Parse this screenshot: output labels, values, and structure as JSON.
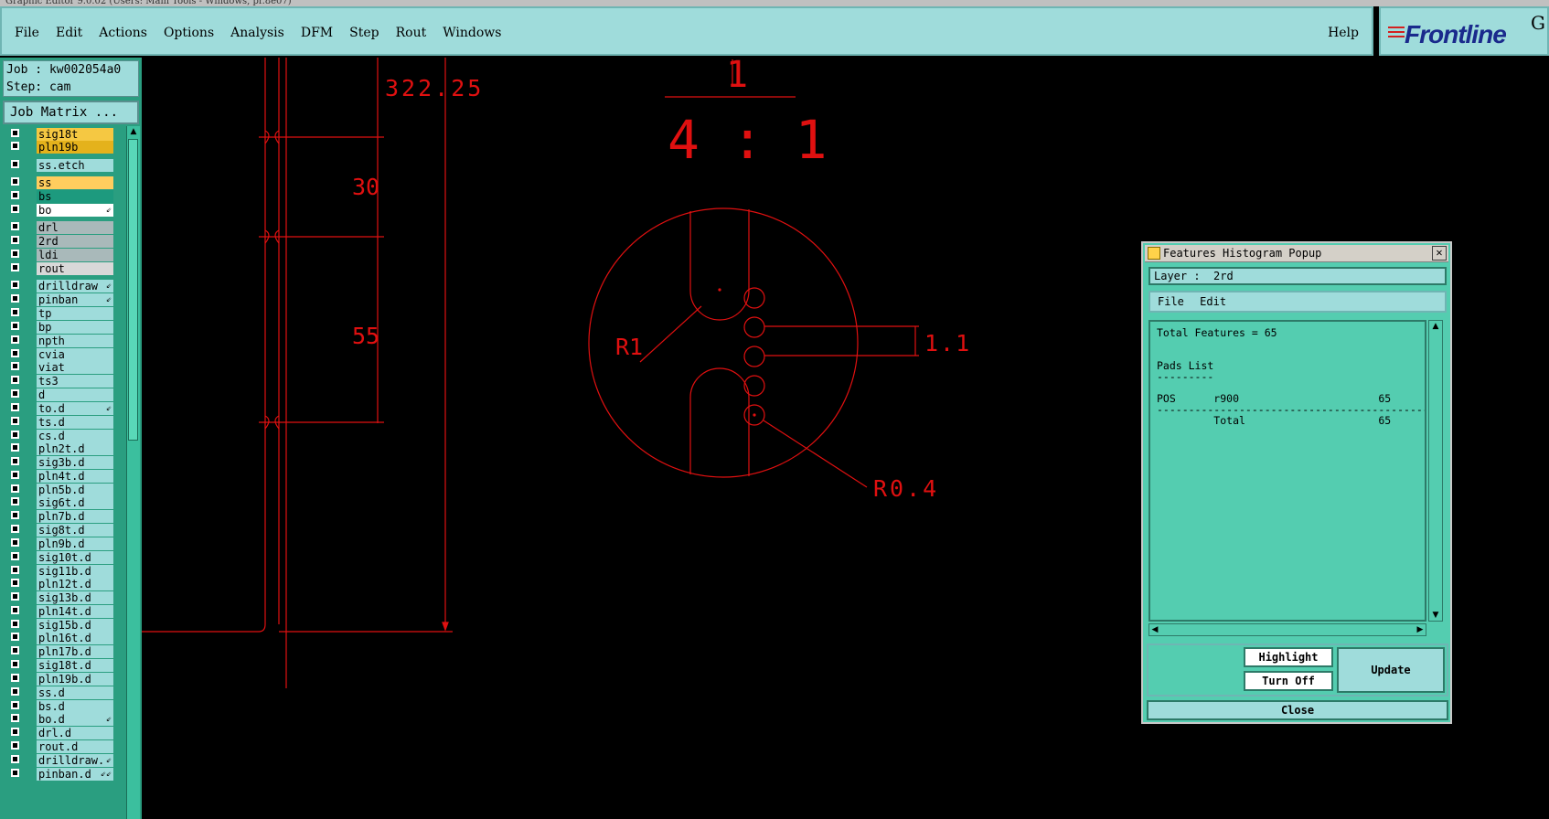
{
  "title_bar": "Graphic Editor 9.0.02 (Users: Main Tools - Windows, pr.8e07)",
  "menu": {
    "items": [
      "File",
      "Edit",
      "Actions",
      "Options",
      "Analysis",
      "DFM",
      "Step",
      "Rout",
      "Windows"
    ],
    "help": "Help"
  },
  "logo": {
    "text": "Frontline",
    "corner": "G"
  },
  "job": {
    "job_line": "Job : kw002054a0",
    "step_line": "Step: cam",
    "matrix_button": "Job Matrix ..."
  },
  "layers": [
    {
      "name": "sig18t",
      "color": "#f5c842"
    },
    {
      "name": "pln19b",
      "color": "#e4b21c"
    },
    {
      "name": "ss.etch",
      "color": "#9fdcdb"
    },
    {
      "name": "ss",
      "color": "#ffcd5e"
    },
    {
      "name": "bs",
      "color": "#1d9a7e"
    },
    {
      "name": "bo",
      "color": "#ffffff",
      "flag": "⇙"
    },
    {
      "name": "drl",
      "color": "#a9b9ba"
    },
    {
      "name": "2rd",
      "color": "#a9b9ba"
    },
    {
      "name": "ldi",
      "color": "#a9b9ba"
    },
    {
      "name": "rout",
      "color": "#d8d8d8"
    },
    {
      "name": "drilldraw",
      "color": "#9fdcdb",
      "flag": "⇙"
    },
    {
      "name": "pinban",
      "color": "#9fdcdb",
      "flag": "⇙"
    },
    {
      "name": "tp",
      "color": "#9fdcdb"
    },
    {
      "name": "bp",
      "color": "#9fdcdb"
    },
    {
      "name": "npth",
      "color": "#9fdcdb"
    },
    {
      "name": "cvia",
      "color": "#9fdcdb"
    },
    {
      "name": "viat",
      "color": "#9fdcdb"
    },
    {
      "name": "ts3",
      "color": "#9fdcdb"
    },
    {
      "name": "d",
      "color": "#9fdcdb"
    },
    {
      "name": "to.d",
      "color": "#9fdcdb",
      "flag": "⇙"
    },
    {
      "name": "ts.d",
      "color": "#9fdcdb"
    },
    {
      "name": "cs.d",
      "color": "#9fdcdb"
    },
    {
      "name": "pln2t.d",
      "color": "#9fdcdb"
    },
    {
      "name": "sig3b.d",
      "color": "#9fdcdb"
    },
    {
      "name": "pln4t.d",
      "color": "#9fdcdb"
    },
    {
      "name": "pln5b.d",
      "color": "#9fdcdb"
    },
    {
      "name": "sig6t.d",
      "color": "#9fdcdb"
    },
    {
      "name": "pln7b.d",
      "color": "#9fdcdb"
    },
    {
      "name": "sig8t.d",
      "color": "#9fdcdb"
    },
    {
      "name": "pln9b.d",
      "color": "#9fdcdb"
    },
    {
      "name": "sig10t.d",
      "color": "#9fdcdb"
    },
    {
      "name": "sig11b.d",
      "color": "#9fdcdb"
    },
    {
      "name": "pln12t.d",
      "color": "#9fdcdb"
    },
    {
      "name": "sig13b.d",
      "color": "#9fdcdb"
    },
    {
      "name": "pln14t.d",
      "color": "#9fdcdb"
    },
    {
      "name": "sig15b.d",
      "color": "#9fdcdb"
    },
    {
      "name": "pln16t.d",
      "color": "#9fdcdb"
    },
    {
      "name": "pln17b.d",
      "color": "#9fdcdb"
    },
    {
      "name": "sig18t.d",
      "color": "#9fdcdb"
    },
    {
      "name": "pln19b.d",
      "color": "#9fdcdb"
    },
    {
      "name": "ss.d",
      "color": "#9fdcdb"
    },
    {
      "name": "bs.d",
      "color": "#9fdcdb"
    },
    {
      "name": "bo.d",
      "color": "#9fdcdb",
      "flag": "⇙"
    },
    {
      "name": "drl.d",
      "color": "#9fdcdb"
    },
    {
      "name": "rout.d",
      "color": "#9fdcdb"
    },
    {
      "name": "drilldraw.",
      "color": "#9fdcdb",
      "flag": "⇙"
    },
    {
      "name": "pinban.d",
      "color": "#9fdcdb",
      "flag": "⇙⇙"
    }
  ],
  "drawing": {
    "dim_top": "322.25",
    "dim_30": "30",
    "dim_55": "55",
    "scale_num": "1",
    "scale_ratio": "4 : 1",
    "label_r1": "R1",
    "label_11": "1.1",
    "label_r04": "R0.4"
  },
  "popup": {
    "title": "Features Histogram Popup",
    "layer_line": "Layer :  2rd",
    "menu": [
      "File",
      "Edit"
    ],
    "report_lines": [
      "Total Features = 65",
      "",
      "",
      "Pads List",
      "---------",
      "",
      "POS      r900                      65",
      "-------------------------------------------",
      "         Total                     65"
    ],
    "buttons": {
      "highlight": "Highlight",
      "turn_off": "Turn Off",
      "update": "Update",
      "close": "Close"
    }
  },
  "colors": {
    "cad_red": "#e01010",
    "panel_teal": "#9fdcdb",
    "popup_green": "#54cdb0"
  }
}
